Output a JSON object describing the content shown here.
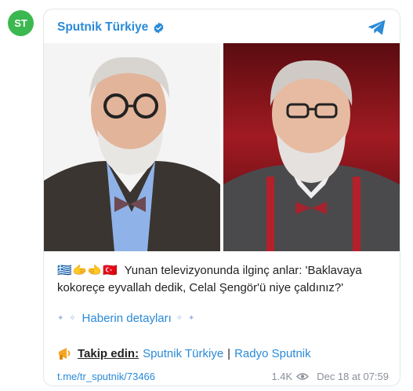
{
  "avatar": {
    "initials": "ST"
  },
  "channel": {
    "name": "Sputnik Türkiye"
  },
  "post": {
    "flags": "🇬🇷🫱‍🫲🇹🇷",
    "text": "Yunan televizyonunda ilginç anlar: 'Baklavaya kokoreçe eyvallah dedik, Celal Şengör'ü niye çaldınız?'",
    "details_link": "Haberin detayları",
    "follow_label": "Takip edin:",
    "follow_links": [
      "Sputnik Türkiye",
      "Radyo Sputnik"
    ],
    "follow_separator": "|",
    "post_link": "t.me/tr_sputnik/73466",
    "views": "1.4K",
    "timestamp": "Dec 18 at 07:59"
  },
  "colors": {
    "accent": "#2a8ad8",
    "avatar_bg": "#3bb84f",
    "meta_text": "#8a9099"
  },
  "icons": {
    "verified": "verified-badge-icon",
    "telegram": "telegram-icon",
    "views": "eye-icon",
    "megaphone": "megaphone-icon"
  }
}
